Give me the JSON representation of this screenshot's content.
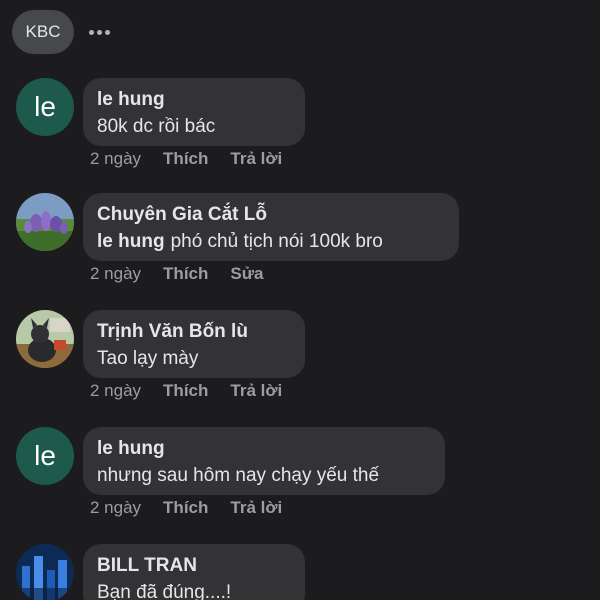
{
  "header": {
    "chip_label": "KBC",
    "more_icon": "more-horizontal-icon"
  },
  "comments": [
    {
      "avatar": "le",
      "author": "le hung",
      "text": "80k dc rồi bác",
      "time": "2 ngày",
      "like_label": "Thích",
      "second_action": "Trả lời"
    },
    {
      "avatar_icon": "lavender-field-photo",
      "author": "Chuyên Gia Cắt Lỗ",
      "mention": "le hung",
      "text": "phó chủ tịch nói 100k bro",
      "time": "2 ngày",
      "like_label": "Thích",
      "second_action": "Sửa"
    },
    {
      "avatar_icon": "dog-photo",
      "author": "Trịnh Văn Bốn lù",
      "text": "Tao lạy mày",
      "time": "2 ngày",
      "like_label": "Thích",
      "second_action": "Trả lời"
    },
    {
      "avatar": "le",
      "author": "le hung",
      "text": "nhưng sau hôm nay chạy yếu thế",
      "time": "2 ngày",
      "like_label": "Thích",
      "second_action": "Trả lời"
    },
    {
      "avatar_icon": "blue-city-photo",
      "author": "BILL TRAN",
      "text": "Bạn đã đúng....!"
    }
  ],
  "colors": {
    "background": "#1c1c1e",
    "bubble": "#333336",
    "letter_avatar": "#1d5a4c",
    "meta_text": "#9a9da3"
  }
}
